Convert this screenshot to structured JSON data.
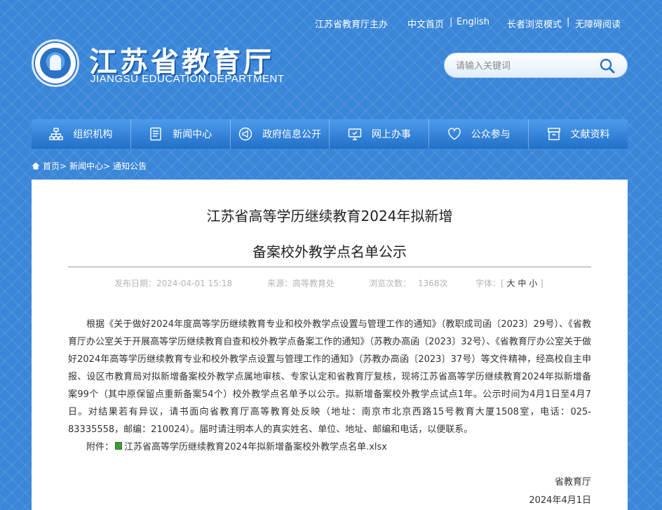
{
  "topbar": {
    "sponsor": "江苏省教育厅主办",
    "home_cn": "中文首页",
    "english": "English",
    "elder_mode": "长者浏览模式",
    "accessible": "无障碍阅读",
    "sep": "|"
  },
  "logo": {
    "cn": "江苏省教育厅",
    "en": "JIANGSU EDUCATION DEPARTMENT"
  },
  "search": {
    "placeholder": "请输入关键词"
  },
  "nav": {
    "items": [
      {
        "label": "组织机构",
        "icon": "org-chart-icon"
      },
      {
        "label": "新闻中心",
        "icon": "document-icon"
      },
      {
        "label": "政府信息公开",
        "icon": "megaphone-icon"
      },
      {
        "label": "网上办事",
        "icon": "monitor-icon"
      },
      {
        "label": "公众参与",
        "icon": "heart-icon"
      },
      {
        "label": "文献资料",
        "icon": "archive-icon"
      }
    ]
  },
  "breadcrumb": {
    "home": "首页",
    "news": "新闻中心",
    "notice": "通知公告",
    "sep": ">"
  },
  "article": {
    "title_line1": "江苏省高等学历继续教育2024年拟新增",
    "title_line2": "备案校外教学点名单公示",
    "meta": {
      "date": "发布日期：2024-04-01 15:18",
      "source": "来源：高等教育处",
      "views_label": "浏览次数：",
      "views": "1368次",
      "font_label": "字体：[",
      "font_large": "大",
      "font_medium": "中",
      "font_small": "小",
      "font_close": "]"
    },
    "body": "根据《关于做好2024年度高等学历继续教育专业和校外教学点设置与管理工作的通知》（教职成司函〔2023〕29号）、《省教育厅办公室关于开展高等学历继续教育自查和校外教学点备案工作的通知》（苏教办高函〔2023〕32号）、《省教育厅办公室关于做好2024年高等学历继续教育专业和校外教学点设置与管理工作的通知》（苏教办高函〔2023〕37号）等文件精神，经高校自主申报、设区市教育局对拟新增备案校外教学点属地审核、专家认定和省教育厅复核，现将江苏省高等学历继续教育2024年拟新增备案99个（其中原保留点重新备案54个）校外教学点名单予以公示。拟新增备案校外教学点试点1年。公示时间为4月1日至4月7日。对结果若有异议，请书面向省教育厅高等教育处反映（地址：南京市北京西路15号教育大厦1508室，电话：025-83335558，邮编：210024）。届时请注明本人的真实姓名、单位、地址、邮编和电话，以便联系。",
    "attachment_label": "附件：",
    "attachment_name": "江苏省高等学历继续教育2024年拟新增备案校外教学点名单.xlsx",
    "signature": "省教育厅",
    "sign_date": "2024年4月1日"
  },
  "colors": {
    "background": "#3a86d8",
    "nav": "#2f7fd6"
  }
}
